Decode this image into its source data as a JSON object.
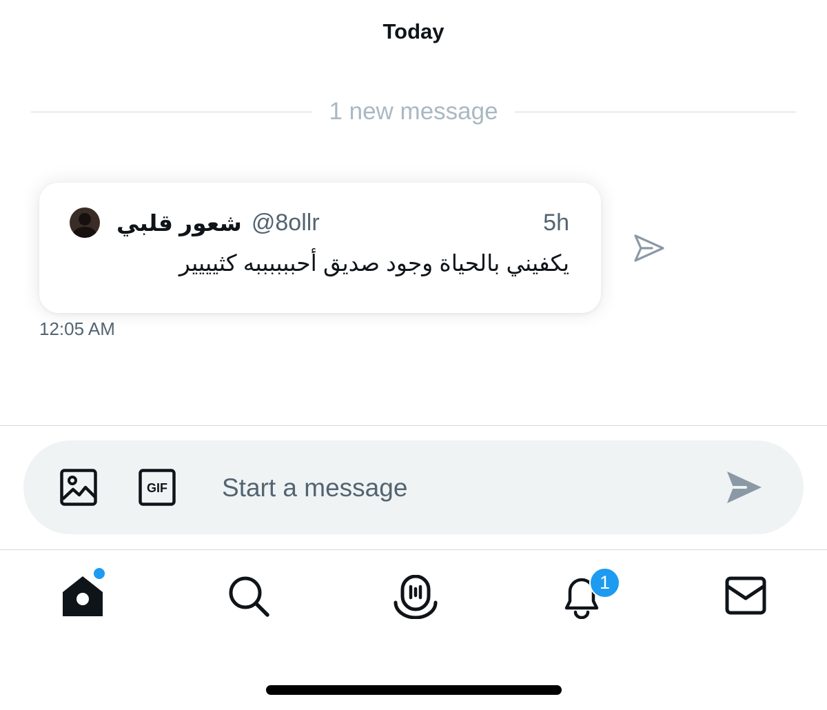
{
  "conversation": {
    "day_header": "Today",
    "divider_text": "1 new message"
  },
  "shared_tweet": {
    "display_name": "شعور قلبي",
    "handle": "@8ollr",
    "time_ago": "5h",
    "text": "يكفيني بالحياة وجود صديق أحببببببه كثيييير"
  },
  "message": {
    "timestamp": "12:05 AM"
  },
  "composer": {
    "placeholder": "Start a message",
    "gif_label": "GIF",
    "icons": [
      "image-icon",
      "gif-icon",
      "send-icon"
    ]
  },
  "bottom_nav": {
    "items": [
      "home",
      "search",
      "spaces",
      "notifications",
      "messages"
    ],
    "notifications_badge": "1",
    "home_has_new": true
  },
  "colors": {
    "accent": "#1d9bf0",
    "text_primary": "#0f1419",
    "text_secondary": "#536471",
    "divider_text": "#aab8c2",
    "composer_bg": "#eff3f4"
  }
}
